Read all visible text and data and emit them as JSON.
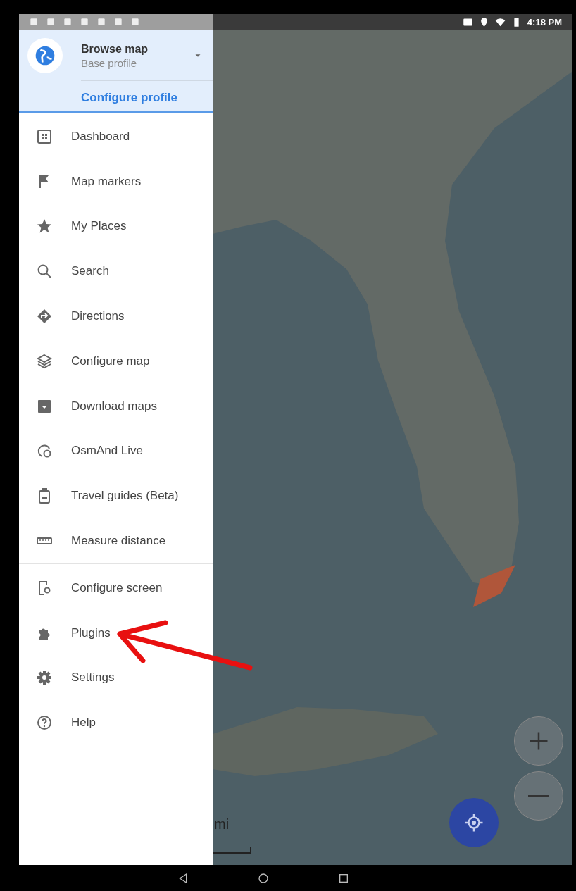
{
  "status_bar": {
    "time": "4:18 PM"
  },
  "profile": {
    "title": "Browse map",
    "subtitle": "Base profile",
    "action": "Configure profile"
  },
  "menu_sections": [
    [
      {
        "label": "Dashboard"
      },
      {
        "label": "Map markers"
      },
      {
        "label": "My Places"
      },
      {
        "label": "Search"
      },
      {
        "label": "Directions"
      },
      {
        "label": "Configure map"
      },
      {
        "label": "Download maps"
      },
      {
        "label": "OsmAnd Live"
      },
      {
        "label": "Travel guides (Beta)"
      },
      {
        "label": "Measure distance"
      }
    ],
    [
      {
        "label": "Configure screen"
      },
      {
        "label": "Plugins"
      },
      {
        "label": "Settings"
      },
      {
        "label": "Help"
      }
    ]
  ],
  "map": {
    "scale_label": "mi"
  }
}
